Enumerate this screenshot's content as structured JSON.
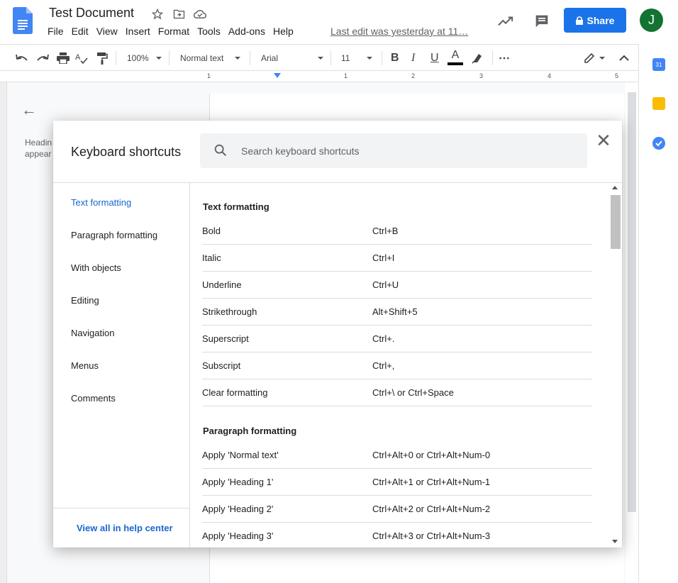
{
  "header": {
    "title": "Test Document",
    "menu": [
      "File",
      "Edit",
      "View",
      "Insert",
      "Format",
      "Tools",
      "Add-ons",
      "Help"
    ],
    "last_edit": "Last edit was yesterday at 11…",
    "share_label": "Share",
    "avatar_initial": "J"
  },
  "toolbar": {
    "zoom": "100%",
    "style": "Normal text",
    "font": "Arial",
    "size": "11",
    "bold": "B",
    "italic": "I",
    "underline": "U",
    "text_color": "A",
    "more": "⋯"
  },
  "ruler": {
    "numbers": [
      "1",
      "1",
      "2",
      "3",
      "4",
      "5"
    ]
  },
  "outline": {
    "text_line1": "Headin",
    "text_line2": "appear"
  },
  "dialog": {
    "title": "Keyboard shortcuts",
    "search_placeholder": "Search keyboard shortcuts",
    "close": "✕",
    "nav": [
      "Text formatting",
      "Paragraph formatting",
      "With objects",
      "Editing",
      "Navigation",
      "Menus",
      "Comments"
    ],
    "nav_active_index": 0,
    "footer_link": "View all in help center",
    "sections": [
      {
        "title": "Text formatting",
        "rows": [
          {
            "name": "Bold",
            "keys": "Ctrl+B"
          },
          {
            "name": "Italic",
            "keys": "Ctrl+I"
          },
          {
            "name": "Underline",
            "keys": "Ctrl+U"
          },
          {
            "name": "Strikethrough",
            "keys": "Alt+Shift+5"
          },
          {
            "name": "Superscript",
            "keys": "Ctrl+."
          },
          {
            "name": "Subscript",
            "keys": "Ctrl+,"
          },
          {
            "name": "Clear formatting",
            "keys": "Ctrl+\\ or Ctrl+Space"
          }
        ]
      },
      {
        "title": "Paragraph formatting",
        "rows": [
          {
            "name": "Apply 'Normal text'",
            "keys": "Ctrl+Alt+0 or Ctrl+Alt+Num-0"
          },
          {
            "name": "Apply 'Heading 1'",
            "keys": "Ctrl+Alt+1 or Ctrl+Alt+Num-1"
          },
          {
            "name": "Apply 'Heading 2'",
            "keys": "Ctrl+Alt+2 or Ctrl+Alt+Num-2"
          },
          {
            "name": "Apply 'Heading 3'",
            "keys": "Ctrl+Alt+3 or Ctrl+Alt+Num-3"
          }
        ]
      }
    ]
  },
  "colors": {
    "accent": "#1a73e8",
    "link": "#1967d2",
    "avatar": "#137333"
  }
}
